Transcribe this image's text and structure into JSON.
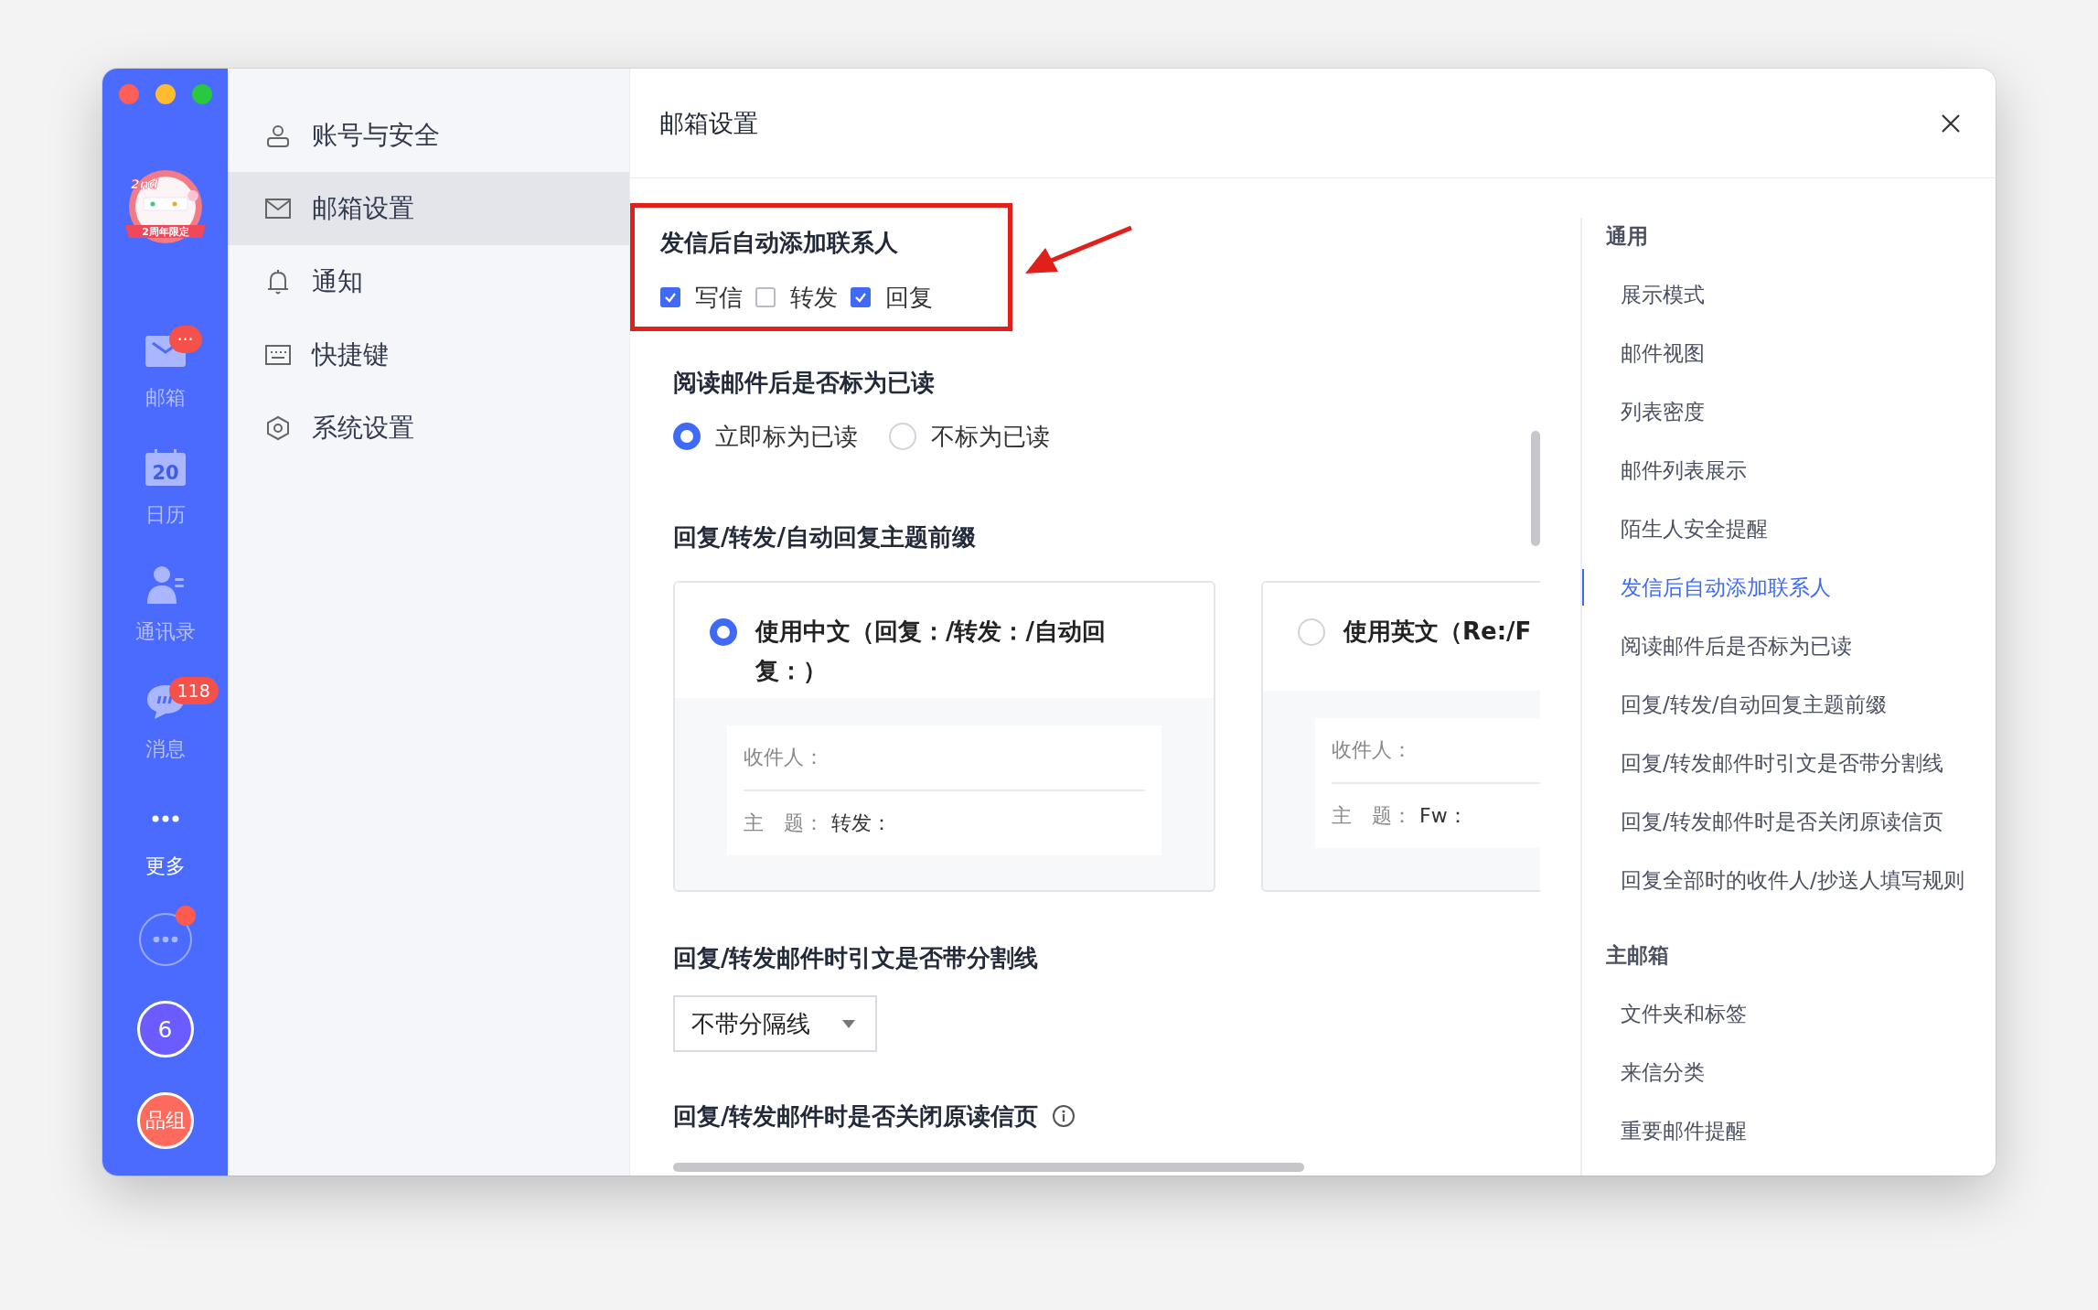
{
  "rail": {
    "promo": {
      "ordinal": "2nd",
      "ribbon": "2周年限定"
    },
    "items": [
      {
        "kind": "mail",
        "label": "邮箱",
        "badge": "···"
      },
      {
        "kind": "calendar",
        "label": "日历",
        "icon_text": "20"
      },
      {
        "kind": "contacts",
        "label": "通讯录"
      },
      {
        "kind": "messages",
        "label": "消息",
        "badge": "118"
      },
      {
        "kind": "more",
        "label": "更多"
      }
    ],
    "bottom": [
      {
        "kind": "apps",
        "dot": true
      },
      {
        "kind": "count",
        "text": "6",
        "color": "#6a5cff"
      },
      {
        "kind": "team",
        "text": "品组",
        "color": "#ff6a5c"
      }
    ]
  },
  "settings_nav": [
    {
      "kind": "account",
      "label": "账号与安全",
      "selected": false
    },
    {
      "kind": "mailbox",
      "label": "邮箱设置",
      "selected": true
    },
    {
      "kind": "notification",
      "label": "通知",
      "selected": false
    },
    {
      "kind": "shortcut",
      "label": "快捷键",
      "selected": false
    },
    {
      "kind": "system",
      "label": "系统设置",
      "selected": false
    }
  ],
  "header": {
    "title": "邮箱设置"
  },
  "sections": [
    {
      "kind": "checkboxes",
      "title": "发信后自动添加联系人",
      "highlighted": true,
      "options": [
        {
          "label": "写信",
          "checked": true
        },
        {
          "label": "转发",
          "checked": false
        },
        {
          "label": "回复",
          "checked": true
        }
      ]
    },
    {
      "kind": "radios",
      "title": "阅读邮件后是否标为已读",
      "options": [
        {
          "label": "立即标为已读",
          "selected": true
        },
        {
          "label": "不标为已读",
          "selected": false
        }
      ]
    },
    {
      "kind": "cards",
      "title": "回复/转发/自动回复主题前缀",
      "cards": [
        {
          "label": "使用中文（回复：/转发：/自动回复：）",
          "selected": true,
          "fields": [
            {
              "label": "收件人："
            },
            {
              "label": "主　题：",
              "value": "转发："
            }
          ]
        },
        {
          "label": "使用英文（Re:/F",
          "selected": false,
          "fields": [
            {
              "label": "收件人："
            },
            {
              "label": "主　题：",
              "value": "Fw："
            }
          ]
        }
      ]
    },
    {
      "kind": "select",
      "title": "回复/转发邮件时引文是否带分割线",
      "value": "不带分隔线"
    },
    {
      "kind": "heading",
      "title": "回复/转发邮件时是否关闭原读信页",
      "info": true
    }
  ],
  "outline": [
    {
      "title": "通用",
      "items": [
        {
          "label": "展示模式",
          "selected": false
        },
        {
          "label": "邮件视图",
          "selected": false
        },
        {
          "label": "列表密度",
          "selected": false
        },
        {
          "label": "邮件列表展示",
          "selected": false
        },
        {
          "label": "陌生人安全提醒",
          "selected": false
        },
        {
          "label": "发信后自动添加联系人",
          "selected": true
        },
        {
          "label": "阅读邮件后是否标为已读",
          "selected": false
        },
        {
          "label": "回复/转发/自动回复主题前缀",
          "selected": false
        },
        {
          "label": "回复/转发邮件时引文是否带分割线",
          "selected": false
        },
        {
          "label": "回复/转发邮件时是否关闭原读信页",
          "selected": false
        },
        {
          "label": "回复全部时的收件人/抄送人填写规则",
          "selected": false
        }
      ]
    },
    {
      "title": "主邮箱",
      "items": [
        {
          "label": "文件夹和标签",
          "selected": false
        },
        {
          "label": "来信分类",
          "selected": false
        },
        {
          "label": "重要邮件提醒",
          "selected": false
        }
      ]
    }
  ]
}
